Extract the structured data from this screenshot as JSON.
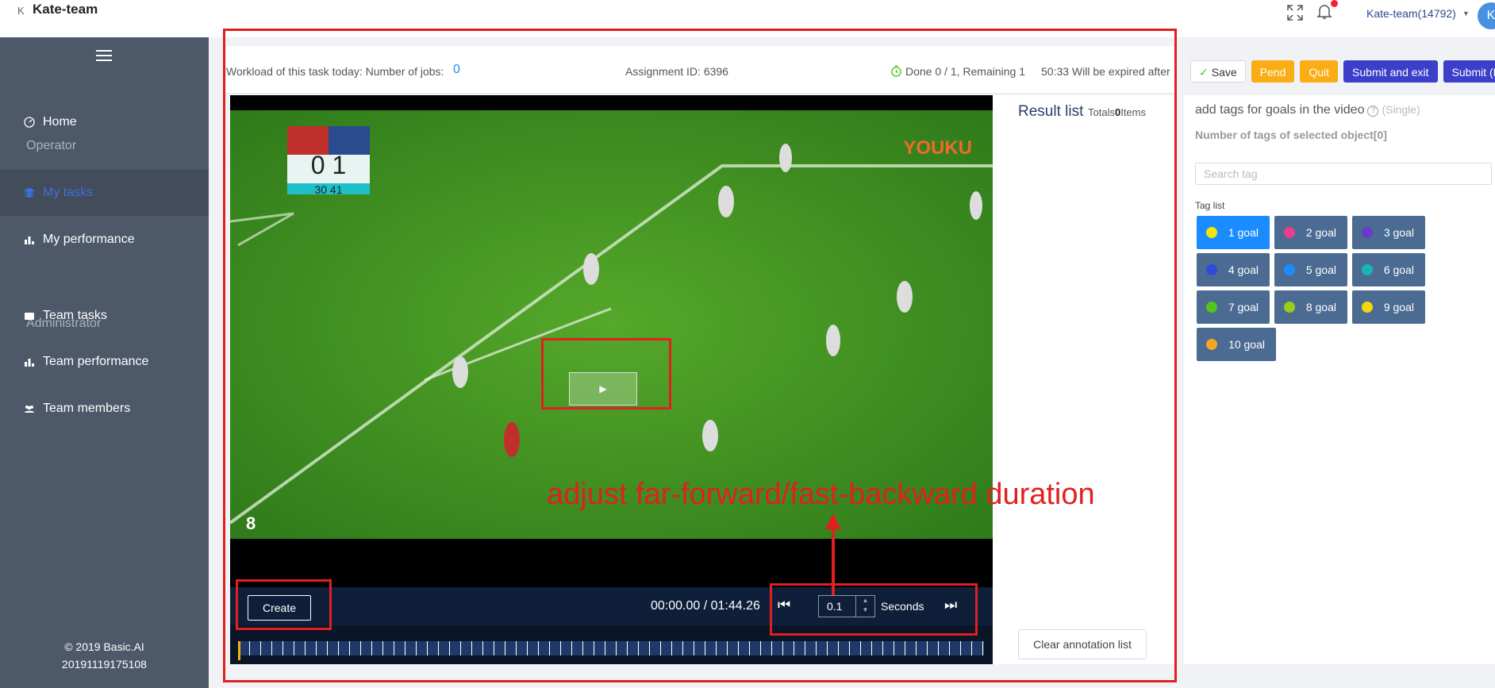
{
  "app": {
    "logo_letter": "K",
    "name": "Kate-team"
  },
  "header": {
    "user": "Kate-team(14792)",
    "avatar_letter": "K"
  },
  "sidebar": {
    "items": [
      {
        "label": "Home"
      },
      {
        "label": "Operator"
      },
      {
        "label": "My tasks"
      },
      {
        "label": "My performance"
      },
      {
        "label": "Administrator"
      },
      {
        "label": "Team tasks"
      },
      {
        "label": "Team performance"
      },
      {
        "label": "Team members"
      }
    ],
    "copyright": "© 2019 Basic.AI",
    "version": "20191119175108"
  },
  "task": {
    "workload_label": "Workload of this task today: Number of jobs:",
    "workload_count": "0",
    "assignment": "Assignment ID: 6396",
    "progress": "Done 0 / 1, Remaining 1",
    "expiry": "50:33 Will be expired after"
  },
  "actions": {
    "save": "Save",
    "pend": "Pend",
    "quit": "Quit",
    "submit_exit": "Submit and exit",
    "submit": "Submit (D"
  },
  "video": {
    "create": "Create",
    "time": "00:00.00 / 01:44.26",
    "step_value": "0.1",
    "seconds": "Seconds",
    "overlay_score": "0  1",
    "overlay_time": "30 41",
    "overlay_logo": "YOUKU",
    "overlay_number": "8"
  },
  "result": {
    "title": "Result list",
    "totals_label": "Totals",
    "totals_count": "0",
    "items_label": "Items",
    "clear": "Clear annotation list"
  },
  "tags": {
    "title": "add tags for goals in the video",
    "mode": "(Single)",
    "count_label": "Number of tags of selected object[0]",
    "search_placeholder": "Search tag",
    "list_label": "Tag list",
    "items": [
      {
        "label": "1 goal",
        "color": "#f5e50a"
      },
      {
        "label": "2 goal",
        "color": "#e83e8c"
      },
      {
        "label": "3 goal",
        "color": "#6a3bc9"
      },
      {
        "label": "4 goal",
        "color": "#2f4bd8"
      },
      {
        "label": "5 goal",
        "color": "#1a8cff"
      },
      {
        "label": "6 goal",
        "color": "#17b6b6"
      },
      {
        "label": "7 goal",
        "color": "#52c41a"
      },
      {
        "label": "8 goal",
        "color": "#9ccc1a"
      },
      {
        "label": "9 goal",
        "color": "#f5d80a"
      },
      {
        "label": "10 goal",
        "color": "#f5a623"
      }
    ]
  },
  "annotation": {
    "text": "adjust far-forward/fast-backward duration"
  }
}
